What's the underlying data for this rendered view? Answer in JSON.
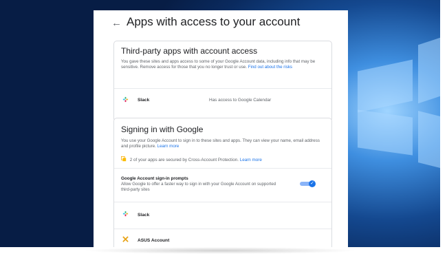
{
  "page": {
    "title": "Apps with access to your account",
    "back_glyph": "←"
  },
  "third_party": {
    "title": "Third-party apps with account access",
    "description": "You gave these sites and apps access to some of your Google Account data, including info that may be sensitive. Remove access for those that you no longer trust or use.",
    "link": "Find out about the risks",
    "apps": [
      {
        "name": "Slack",
        "access": "Has access to Google Calendar",
        "icon": "slack-icon"
      }
    ]
  },
  "signing_in": {
    "title": "Signing in with Google",
    "description": "You use your Google Account to sign in to these sites and apps. They can view your name, email address and profile picture.",
    "link": "Learn more",
    "protection_text": "2 of your apps are secured by Cross-Account Protection.",
    "protection_link": "Learn more",
    "protection_icon": "shield-icon",
    "prompts_title": "Google Account sign-in prompts",
    "prompts_desc": "Allow Google to offer a faster way to sign in with your Google Account on supported third-party sites",
    "prompts_enabled": true,
    "toggle_check": "✓",
    "apps": [
      {
        "name": "Slack",
        "icon": "slack-icon"
      },
      {
        "name": "ASUS Account",
        "icon": "asus-icon"
      }
    ]
  },
  "colors": {
    "link": "#1a73e8",
    "desktop_blue": "#14488f",
    "toggle_on": "#1a73e8"
  }
}
